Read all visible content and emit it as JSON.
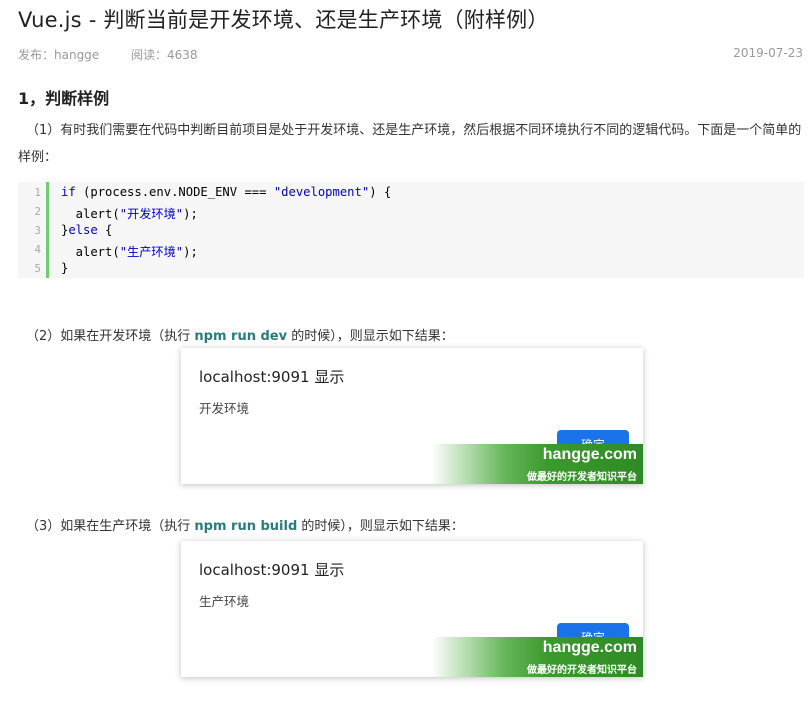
{
  "article": {
    "title": "Vue.js - 判断当前是开发环境、还是生产环境（附样例）",
    "publish_label": "发布：hangge",
    "reads_label": "阅读：4638",
    "date": "2019-07-23",
    "section_title": "1，判断样例",
    "intro": "（1）有时我们需要在代码中判断目前项目是处于开发环境、还是生产环境，然后根据不同环境执行不同的逻辑代码。下面是一个简单的样例："
  },
  "code": {
    "line_numbers": [
      "1",
      "2",
      "3",
      "4",
      "5"
    ]
  },
  "step2": {
    "prefix": "（2）如果在开发环境（执行 ",
    "cmd": "npm run dev",
    "suffix": " 的时候），则显示如下结果："
  },
  "step3": {
    "prefix": "（3）如果在生产环境（执行 ",
    "cmd": "npm run build",
    "suffix": " 的时候），则显示如下结果："
  },
  "dialog1": {
    "title": "localhost:9091 显示",
    "message": "开发环境",
    "ok_label": "确定"
  },
  "dialog2": {
    "title": "localhost:9091 显示",
    "message": "生产环境",
    "ok_label": "确定"
  },
  "watermark": {
    "site": "hangge.com",
    "slogan": "做最好的开发者知识平台"
  },
  "colors": {
    "accent": "#2a7c7c",
    "code_gutter": "#6ccd73",
    "keyword": "#0000cc",
    "button": "#1a73e8",
    "watermark": "#3b9a2d"
  }
}
